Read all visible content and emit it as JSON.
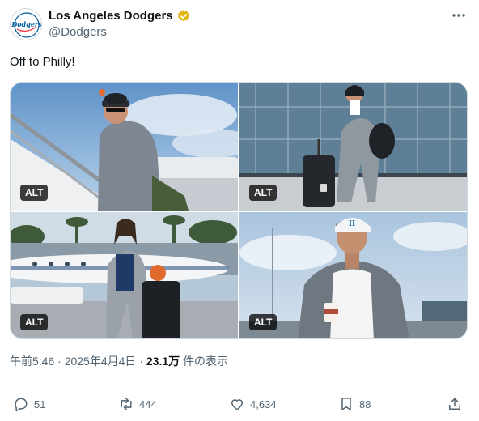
{
  "account": {
    "display_name": "Los Angeles Dodgers",
    "handle": "@Dodgers",
    "verified": true,
    "verified_color": "#e2b719",
    "logo_text": "Dodgers"
  },
  "tweet": {
    "text": "Off to Philly!"
  },
  "media": {
    "alt_label": "ALT",
    "images": [
      {
        "alt_badge": "ALT"
      },
      {
        "alt_badge": "ALT"
      },
      {
        "alt_badge": "ALT"
      },
      {
        "alt_badge": "ALT"
      }
    ]
  },
  "meta": {
    "time": "午前5:46",
    "separator": "·",
    "date": "2025年4月4日",
    "views_count": "23.1万",
    "views_label": "件の表示"
  },
  "actions": {
    "replies": "51",
    "reposts": "444",
    "likes": "4,634",
    "bookmarks": "88"
  },
  "colors": {
    "dodger_blue": "#005a9c",
    "text_primary": "#0f1419",
    "text_secondary": "#536471"
  }
}
